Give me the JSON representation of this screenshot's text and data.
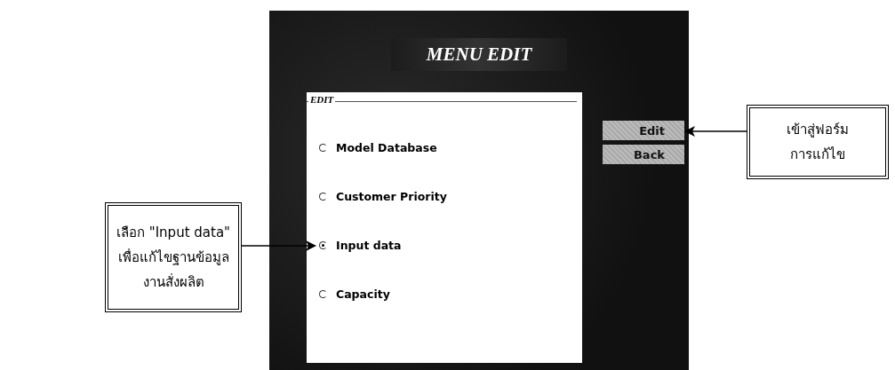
{
  "window": {
    "title": "MENU EDIT"
  },
  "group": {
    "label": "EDIT",
    "options": [
      {
        "label": "Model Database",
        "selected": false
      },
      {
        "label": "Customer Priority",
        "selected": false
      },
      {
        "label": "Input data",
        "selected": true
      },
      {
        "label": "Capacity",
        "selected": false
      }
    ]
  },
  "buttons": [
    {
      "label": "Edit"
    },
    {
      "label": "Back"
    }
  ],
  "callouts": [
    {
      "kind": "right",
      "lines": [
        "เข้าสู่ฟอร์ม",
        "การแก้ไข"
      ]
    },
    {
      "kind": "left",
      "lines": [
        "เลือก \"Input data\"",
        "เพื่อแก้ไขฐานข้อมูล",
        "งานสั่งผลิต"
      ]
    }
  ]
}
